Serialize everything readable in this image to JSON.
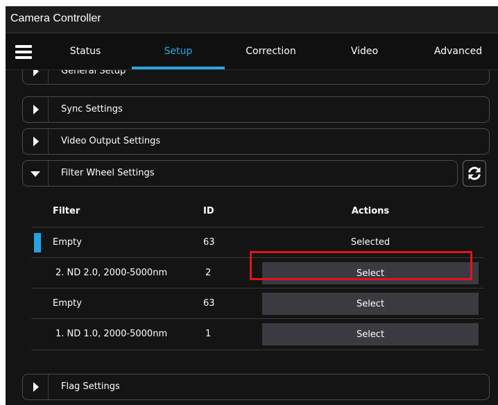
{
  "window": {
    "title": "Camera Controller"
  },
  "nav": {
    "menu_icon": "hamburger-menu-icon",
    "tabs": [
      {
        "label": "Status",
        "active": false
      },
      {
        "label": "Setup",
        "active": true
      },
      {
        "label": "Correction",
        "active": false
      },
      {
        "label": "Video",
        "active": false
      },
      {
        "label": "Advanced",
        "active": false
      }
    ],
    "accent_color": "#2aa7df"
  },
  "sections": [
    {
      "label": "General Setup",
      "expanded": false
    },
    {
      "label": "Sync Settings",
      "expanded": false
    },
    {
      "label": "Video Output Settings",
      "expanded": false
    },
    {
      "label": "Filter Wheel Settings",
      "expanded": true
    },
    {
      "label": "Flag Settings",
      "expanded": false
    }
  ],
  "filter_wheel": {
    "refresh_icon": "refresh-icon",
    "headers": {
      "filter": "Filter",
      "id": "ID",
      "actions": "Actions"
    },
    "rows": [
      {
        "filter": "Empty",
        "id": "63",
        "action": "Selected",
        "is_selected": true
      },
      {
        "filter": "2. ND  2.0, 2000-5000nm",
        "id": "2",
        "action": "Select",
        "is_selected": false
      },
      {
        "filter": "Empty",
        "id": "63",
        "action": "Select",
        "is_selected": false
      },
      {
        "filter": "1. ND  1.0, 2000-5000nm",
        "id": "1",
        "action": "Select",
        "is_selected": false
      }
    ],
    "selected_indicator_color": "#23a3e0",
    "highlight_color": "#e0141e"
  }
}
